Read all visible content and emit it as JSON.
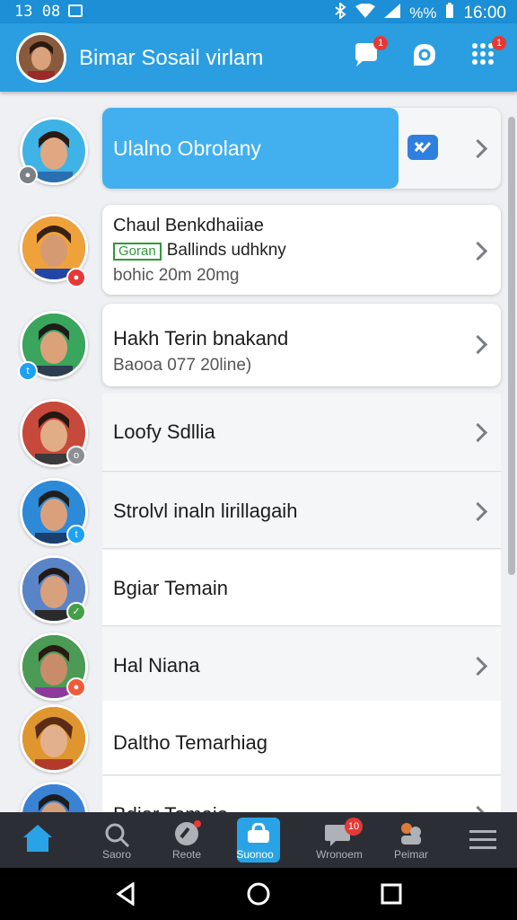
{
  "status": {
    "time": "13 08",
    "battery": "%%",
    "clock": "16:00"
  },
  "app": {
    "title": "Bimar Sosail virlam"
  },
  "header_badges": {
    "notifications": "1",
    "grid": "1"
  },
  "contacts": [
    {
      "name": "Ulalno Obrolany",
      "subtitle": "",
      "tag": "",
      "selected": true
    },
    {
      "name": "Chaul Benkdhaiiae",
      "tag": "Goran",
      "tag_text": "Ballinds udhkny",
      "subtitle": "bohic 20m 20mg"
    },
    {
      "name": "Hakh Terin bnakand",
      "subtitle": "Baooa 077 20line)"
    },
    {
      "name": "Loofy Sdllia",
      "subtitle": ""
    },
    {
      "name": "Strolvl inaln lirillagaih",
      "subtitle": ""
    },
    {
      "name": "Bgiar Temain",
      "subtitle": ""
    },
    {
      "name": "Hal Niana",
      "subtitle": ""
    },
    {
      "name": "Daltho Temarhiag",
      "subtitle": ""
    },
    {
      "name": "Bdiar Temaio",
      "subtitle": ""
    }
  ],
  "nav": {
    "home": "",
    "search": "Saoro",
    "recents": "Reote",
    "active": "Suonoo",
    "messages": "Wronoem",
    "messages_badge": "10",
    "people": "Peimar"
  },
  "colors": {
    "accent": "#2a9ee0",
    "selected": "#42b0ee",
    "navbar": "#2b2f35"
  }
}
